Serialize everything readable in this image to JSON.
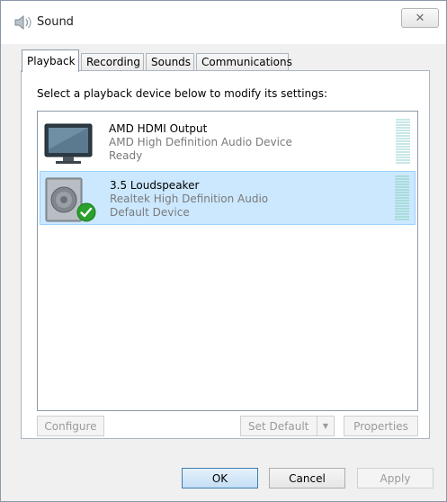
{
  "window": {
    "title": "Sound",
    "close_glyph": "✕"
  },
  "tabs": [
    {
      "label": "Playback",
      "active": true
    },
    {
      "label": "Recording",
      "active": false
    },
    {
      "label": "Sounds",
      "active": false
    },
    {
      "label": "Communications",
      "active": false
    }
  ],
  "instruction": "Select a playback device below to modify its settings:",
  "devices": [
    {
      "name": "AMD HDMI Output",
      "description": "AMD High Definition Audio Device",
      "status": "Ready",
      "icon": "monitor-icon",
      "selected": false,
      "is_default": false
    },
    {
      "name": "3.5 Loudspeaker",
      "description": "Realtek High Definition Audio",
      "status": "Default Device",
      "icon": "speaker-icon",
      "selected": true,
      "is_default": true
    }
  ],
  "panel_buttons": {
    "configure": {
      "label": "Configure",
      "enabled": false
    },
    "set_default": {
      "label": "Set Default",
      "enabled": false
    },
    "properties": {
      "label": "Properties",
      "enabled": false
    }
  },
  "dialog_buttons": {
    "ok": {
      "label": "OK"
    },
    "cancel": {
      "label": "Cancel"
    },
    "apply": {
      "label": "Apply",
      "enabled": false
    }
  },
  "colors": {
    "selection_bg": "#cce8ff",
    "selection_border": "#99d1ff",
    "default_check": "#2aa12a",
    "meter": "#c7e7e7"
  }
}
